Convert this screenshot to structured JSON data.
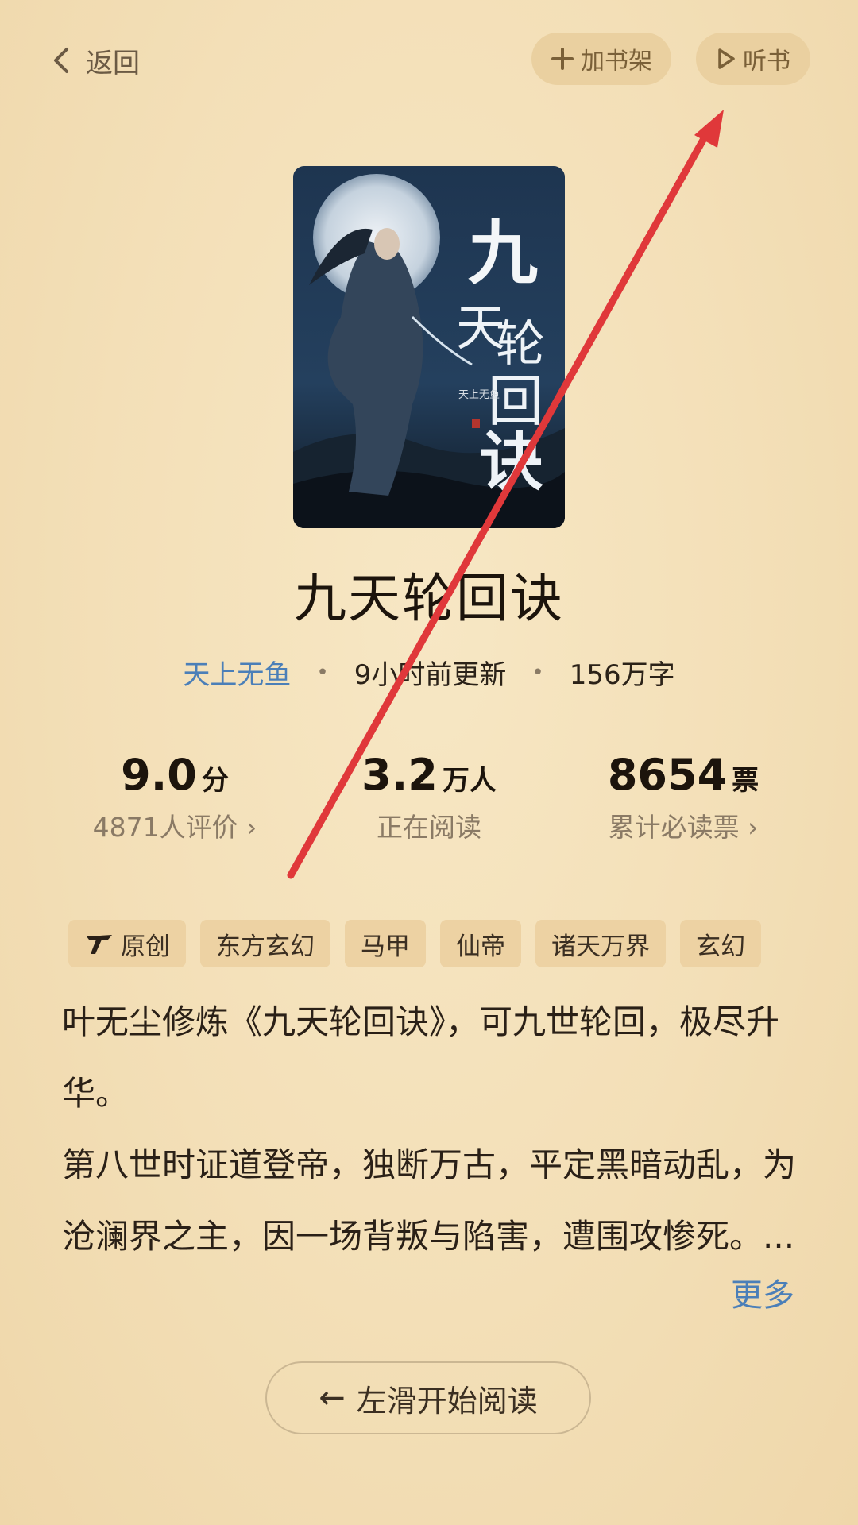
{
  "header": {
    "back_label": "返回",
    "add_shelf_label": "加书架",
    "listen_label": "听书"
  },
  "book": {
    "title": "九天轮回诀",
    "author": "天上无鱼",
    "updated": "9小时前更新",
    "word_count": "156万字",
    "cover_title": "九天轮回诀",
    "cover_author": "天上无鱼"
  },
  "stats": [
    {
      "value": "9.0",
      "unit": "分",
      "caption": "4871人评价 ›"
    },
    {
      "value": "3.2",
      "unit": "万人",
      "caption": "正在阅读"
    },
    {
      "value": "8654",
      "unit": "票",
      "caption": "累计必读票 ›"
    }
  ],
  "tags": [
    "原创",
    "东方玄幻",
    "马甲",
    "仙帝",
    "诸天万界",
    "玄幻"
  ],
  "description": {
    "para1": "叶无尘修炼《九天轮回诀》，可九世轮回，极尽升华。",
    "para2": "第八世时证道登帝，独断万古，平定黑暗动乱，为沧澜界之主，因一场背叛与陷害，遭围攻惨死。...",
    "more_label": "更多"
  },
  "start_button": {
    "arrow": "←",
    "label": "左滑开始阅读"
  },
  "colors": {
    "background": "#f3dfb7",
    "accent_blue": "#4b7fb8",
    "pill_bg": "#ead0a0",
    "annotation_red": "#e0383a"
  }
}
